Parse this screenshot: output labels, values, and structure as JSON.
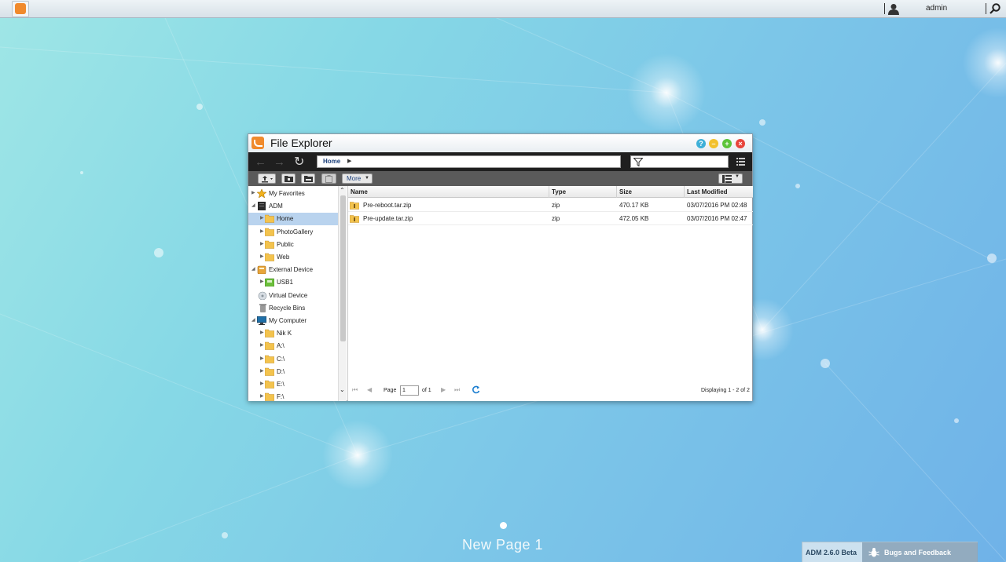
{
  "topbar": {
    "username": "admin"
  },
  "window": {
    "title": "File Explorer",
    "address": {
      "crumb": "Home"
    },
    "toolbar": {
      "more_label": "More"
    },
    "tree": [
      {
        "label": "My Favorites",
        "icon": "star-icon"
      },
      {
        "label": "ADM",
        "icon": "server-icon"
      },
      {
        "label": "Home",
        "icon": "folder-icon",
        "selected": true
      },
      {
        "label": "PhotoGallery",
        "icon": "folder-icon"
      },
      {
        "label": "Public",
        "icon": "folder-icon"
      },
      {
        "label": "Web",
        "icon": "folder-icon"
      },
      {
        "label": "External Device",
        "icon": "external-device-icon"
      },
      {
        "label": "USB1",
        "icon": "usb-icon"
      },
      {
        "label": "Virtual Device",
        "icon": "virtual-device-icon"
      },
      {
        "label": "Recycle Bins",
        "icon": "trash-icon"
      },
      {
        "label": "My Computer",
        "icon": "monitor-icon"
      },
      {
        "label": "Nik K",
        "icon": "folder-icon"
      },
      {
        "label": "A:\\",
        "icon": "folder-icon"
      },
      {
        "label": "C:\\",
        "icon": "folder-icon"
      },
      {
        "label": "D:\\",
        "icon": "folder-icon"
      },
      {
        "label": "E:\\",
        "icon": "folder-icon"
      },
      {
        "label": "F:\\",
        "icon": "folder-icon"
      }
    ],
    "columns": {
      "name": "Name",
      "type": "Type",
      "size": "Size",
      "modified": "Last Modified"
    },
    "files": [
      {
        "name": "Pre-reboot.tar.zip",
        "type": "zip",
        "size": "470.17 KB",
        "modified": "03/07/2016 PM 02:48"
      },
      {
        "name": "Pre-update.tar.zip",
        "type": "zip",
        "size": "472.05 KB",
        "modified": "03/07/2016 PM 02:47"
      }
    ],
    "pager": {
      "page_label": "Page",
      "page_value": "1",
      "of_label": "of 1",
      "display": "Displaying 1 - 2 of 2"
    }
  },
  "desktop": {
    "page_name": "New Page 1",
    "version": "ADM 2.6.0 Beta",
    "feedback": "Bugs and Feedback"
  },
  "colors": {
    "accent": "#f08a2c",
    "selected_row": "#b9d3ee",
    "breadcrumb": "#1b3f7a"
  }
}
